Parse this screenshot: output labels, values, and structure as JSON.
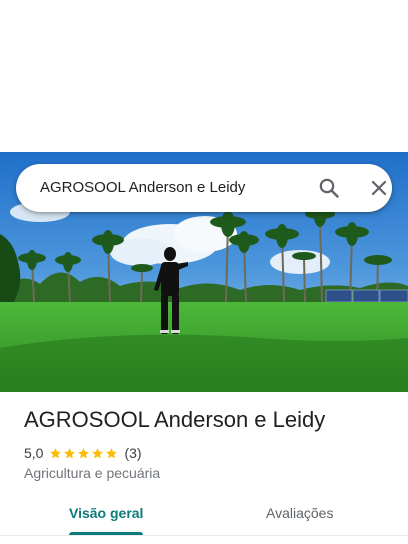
{
  "search": {
    "query": "AGROSOOL Anderson e Leidy"
  },
  "place": {
    "name": "AGROSOOL Anderson e Leidy",
    "rating": "5,0",
    "stars": 5,
    "review_count": "(3)",
    "category": "Agricultura e pecuária"
  },
  "tabs": [
    {
      "label": "Visão geral",
      "selected": true
    },
    {
      "label": "Avaliações",
      "selected": false
    }
  ],
  "colors": {
    "accent": "#0b7a78",
    "star": "#fbbc04"
  },
  "icons": {
    "search": "search-icon",
    "close": "close-icon"
  }
}
